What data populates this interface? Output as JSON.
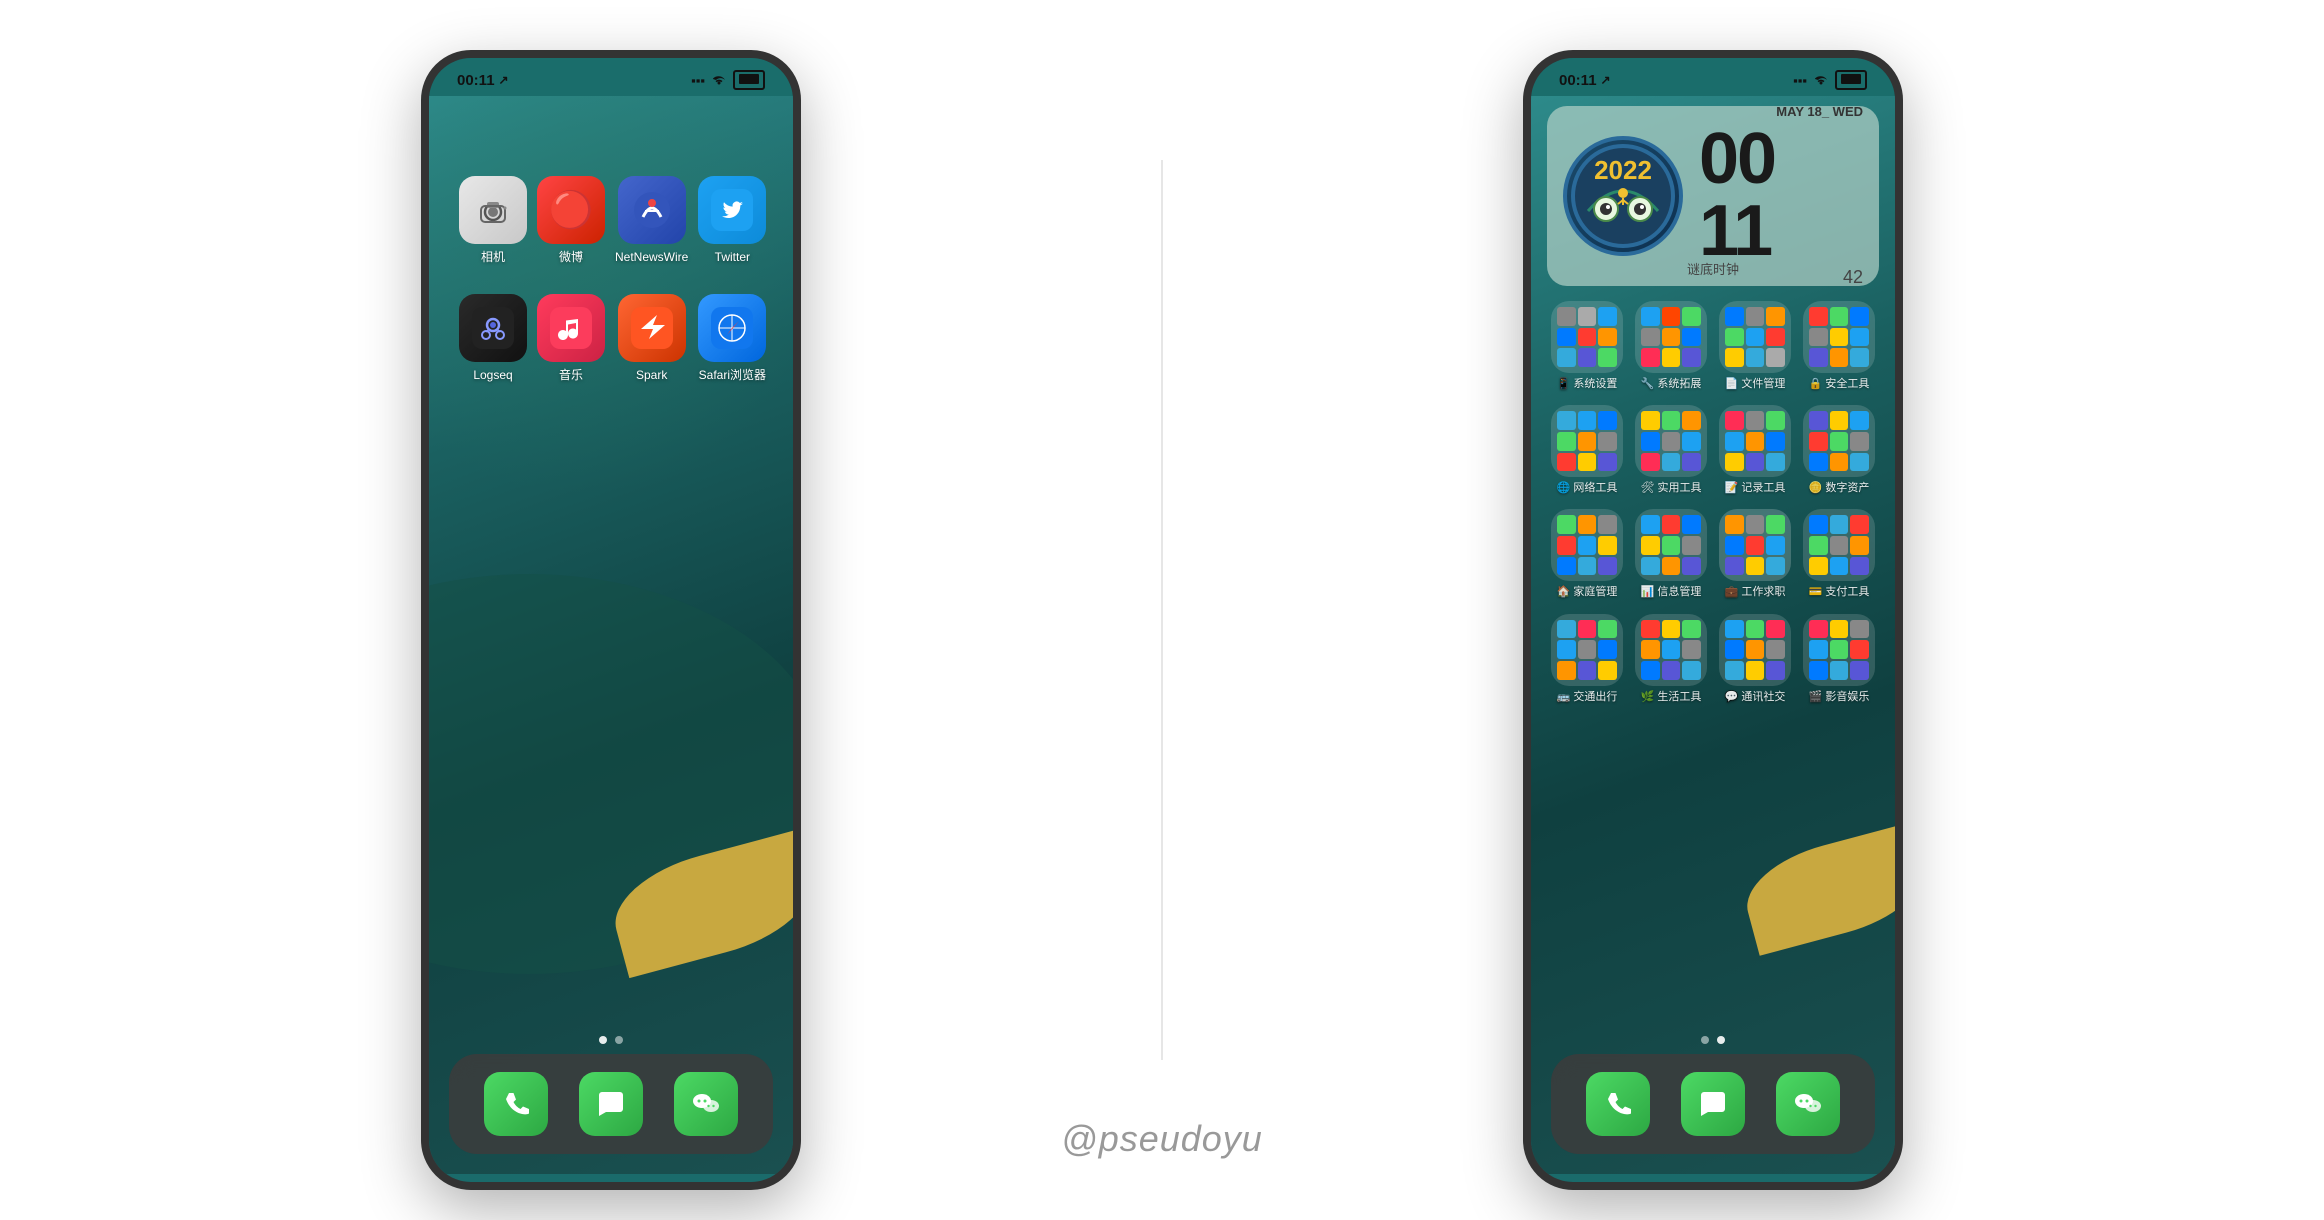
{
  "page": {
    "background": "#ffffff",
    "watermark": "@pseudoyu"
  },
  "left_phone": {
    "status": {
      "time": "00:11",
      "signal_icon": "signal",
      "wifi_icon": "wifi",
      "battery_icon": "battery",
      "location_icon": "location"
    },
    "apps_row1": [
      {
        "id": "camera",
        "label": "相机",
        "icon_type": "camera"
      },
      {
        "id": "weibo",
        "label": "微博",
        "icon_type": "weibo"
      },
      {
        "id": "netnewswire",
        "label": "NetNewsWire",
        "icon_type": "netnews"
      },
      {
        "id": "twitter",
        "label": "Twitter",
        "icon_type": "twitter"
      }
    ],
    "apps_row2": [
      {
        "id": "logseq",
        "label": "Logseq",
        "icon_type": "logseq"
      },
      {
        "id": "music",
        "label": "音乐",
        "icon_type": "music"
      },
      {
        "id": "spark",
        "label": "Spark",
        "icon_type": "spark"
      },
      {
        "id": "safari",
        "label": "Safari浏览器",
        "icon_type": "safari"
      }
    ],
    "dock": [
      {
        "id": "phone",
        "label": "电话",
        "icon_type": "phone"
      },
      {
        "id": "messages",
        "label": "信息",
        "icon_type": "messages"
      },
      {
        "id": "wechat",
        "label": "微信",
        "icon_type": "wechat"
      }
    ],
    "page_dots": [
      {
        "active": true
      },
      {
        "active": false
      }
    ]
  },
  "right_phone": {
    "status": {
      "time": "00:11",
      "signal_icon": "signal",
      "wifi_icon": "wifi",
      "battery_icon": "battery",
      "location_icon": "location"
    },
    "clock_widget": {
      "badge_text": "2022",
      "date": "MAY 18_ WED",
      "hours": "00",
      "minutes": "11",
      "seconds": "42",
      "widget_name": "谜底时钟"
    },
    "folders": [
      {
        "id": "system-settings",
        "label": "系统设置",
        "colors": [
          "#888",
          "#aaa",
          "#1da1f2",
          "#007aff",
          "#ff3b30",
          "#ff9500",
          "#34aadc",
          "#5856d6",
          "#4cd964"
        ]
      },
      {
        "id": "system-ext",
        "label": "系统拓展",
        "colors": [
          "#1da1f2",
          "#ff4500",
          "#4cd964",
          "#888",
          "#ff9500",
          "#007aff",
          "#ff2d55",
          "#ffcc00",
          "#5856d6"
        ]
      },
      {
        "id": "file-mgmt",
        "label": "文件管理",
        "colors": [
          "#007aff",
          "#888",
          "#ff9500",
          "#4cd964",
          "#1da1f2",
          "#ff3b30",
          "#ffcc00",
          "#34aadc",
          "#aaa"
        ]
      },
      {
        "id": "security",
        "label": "安全工具",
        "colors": [
          "#ff3b30",
          "#4cd964",
          "#007aff",
          "#888",
          "#ffcc00",
          "#1da1f2",
          "#5856d6",
          "#ff9500",
          "#34aadc"
        ]
      },
      {
        "id": "network",
        "label": "网络工具",
        "colors": [
          "#34aadc",
          "#1da1f2",
          "#007aff",
          "#4cd964",
          "#ff9500",
          "#888",
          "#ff3b30",
          "#ffcc00",
          "#5856d6"
        ]
      },
      {
        "id": "utility",
        "label": "实用工具",
        "colors": [
          "#ffcc00",
          "#4cd964",
          "#ff9500",
          "#007aff",
          "#888",
          "#1da1f2",
          "#ff2d55",
          "#34aadc",
          "#5856d6"
        ]
      },
      {
        "id": "recording",
        "label": "记录工具",
        "colors": [
          "#ff2d55",
          "#888",
          "#4cd964",
          "#1da1f2",
          "#ff9500",
          "#007aff",
          "#ffcc00",
          "#5856d6",
          "#34aadc"
        ]
      },
      {
        "id": "digital-assets",
        "label": "数字资产",
        "colors": [
          "#5856d6",
          "#ffcc00",
          "#1da1f2",
          "#ff3b30",
          "#4cd964",
          "#888",
          "#007aff",
          "#ff9500",
          "#34aadc"
        ]
      },
      {
        "id": "family-mgmt",
        "label": "家庭管理",
        "colors": [
          "#4cd964",
          "#ff9500",
          "#888",
          "#ff3b30",
          "#1da1f2",
          "#ffcc00",
          "#007aff",
          "#34aadc",
          "#5856d6"
        ]
      },
      {
        "id": "info-mgmt",
        "label": "信息管理",
        "colors": [
          "#1da1f2",
          "#ff3b30",
          "#007aff",
          "#ffcc00",
          "#4cd964",
          "#888",
          "#34aadc",
          "#ff9500",
          "#5856d6"
        ]
      },
      {
        "id": "work-job",
        "label": "工作求职",
        "colors": [
          "#ff9500",
          "#888",
          "#4cd964",
          "#007aff",
          "#ff3b30",
          "#1da1f2",
          "#5856d6",
          "#ffcc00",
          "#34aadc"
        ]
      },
      {
        "id": "payment",
        "label": "支付工具",
        "colors": [
          "#007aff",
          "#34aadc",
          "#ff3b30",
          "#4cd964",
          "#888",
          "#ff9500",
          "#ffcc00",
          "#1da1f2",
          "#5856d6"
        ]
      },
      {
        "id": "transport",
        "label": "交通出行",
        "colors": [
          "#34aadc",
          "#ff2d55",
          "#4cd964",
          "#1da1f2",
          "#888",
          "#007aff",
          "#ff9500",
          "#5856d6",
          "#ffcc00"
        ]
      },
      {
        "id": "lifestyle",
        "label": "生活工具",
        "colors": [
          "#ff3b30",
          "#ffcc00",
          "#4cd964",
          "#ff9500",
          "#1da1f2",
          "#888",
          "#007aff",
          "#5856d6",
          "#34aadc"
        ]
      },
      {
        "id": "social",
        "label": "通讯社交",
        "colors": [
          "#1da1f2",
          "#4cd964",
          "#ff2d55",
          "#007aff",
          "#ff9500",
          "#888",
          "#34aadc",
          "#ffcc00",
          "#5856d6"
        ]
      },
      {
        "id": "entertainment",
        "label": "影音娱乐",
        "colors": [
          "#ff2d55",
          "#ffcc00",
          "#888",
          "#1da1f2",
          "#4cd964",
          "#ff3b30",
          "#007aff",
          "#34aadc",
          "#5856d6"
        ]
      }
    ],
    "dock": [
      {
        "id": "phone",
        "label": "电话",
        "icon_type": "phone"
      },
      {
        "id": "messages",
        "label": "信息",
        "icon_type": "messages"
      },
      {
        "id": "wechat",
        "label": "微信",
        "icon_type": "wechat"
      }
    ],
    "page_dots": [
      {
        "active": false
      },
      {
        "active": true
      }
    ]
  }
}
